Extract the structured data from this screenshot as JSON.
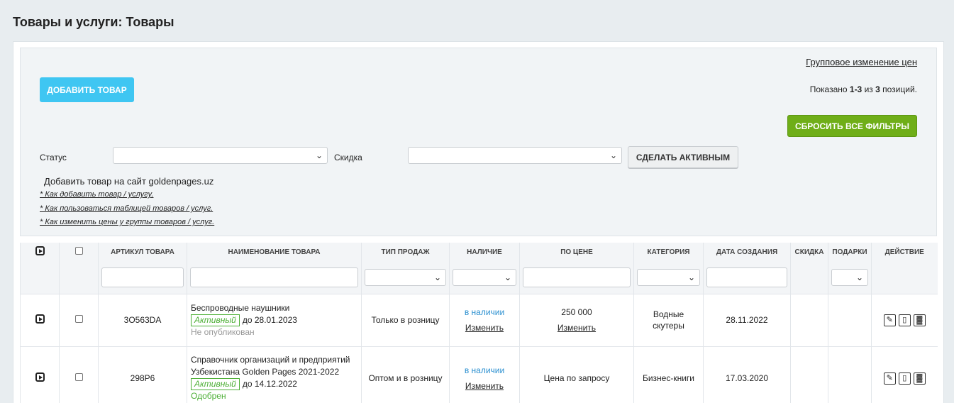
{
  "page": {
    "title": "Товары и услуги: Товары"
  },
  "toolbar": {
    "bulk_price_link": "Групповое изменение цен",
    "add_button": "ДОБАВИТЬ ТОВАР",
    "shown_prefix": "Показано ",
    "shown_range": "1-3",
    "shown_mid": " из ",
    "shown_total": "3",
    "shown_suffix": " позиций.",
    "reset_button": "СБРОСИТЬ ВСЕ ФИЛЬТРЫ",
    "status_label": "Статус",
    "discount_label": "Скидка",
    "make_active_button": "СДЕЛАТЬ АКТИВНЫМ",
    "hint": "Добавить товар на сайт goldenpages.uz",
    "help_links": [
      "* Как добавить товар / услугу.",
      "* Как пользоваться таблицей товаров / услуг.",
      "* Как изменить цены у группы товаров / услуг."
    ]
  },
  "table": {
    "headers": [
      "АРТИКУЛ ТОВАРА",
      "НАИМЕНОВАНИЕ ТОВАРА",
      "ТИП ПРОДАЖ",
      "НАЛИЧИЕ",
      "ПО ЦЕНЕ",
      "КАТЕГОРИЯ",
      "ДАТА СОЗДАНИЯ",
      "СКИДКА",
      "ПОДАРКИ",
      "ДЕЙСТВИЕ"
    ],
    "rows": [
      {
        "sku": "3O563DA",
        "name": "Беспроводные наушники",
        "status": "Активный",
        "until": "до 28.01.2023",
        "publish": "Не опубликован",
        "sale_type": "Только в розницу",
        "availability": "в наличии",
        "availability_edit": "Изменить",
        "price": "250 000",
        "price_edit": "Изменить",
        "category": "Водные скутеры",
        "created": "28.11.2022"
      },
      {
        "sku": "298P6",
        "name": "Справочник организаций и предприятий Узбекистана Golden Pages 2021-2022",
        "status": "Активный",
        "until": "до 14.12.2022",
        "publish": "Одобрен",
        "sale_type": "Оптом и в розницу",
        "availability": "в наличии",
        "availability_edit": "Изменить",
        "price": "Цена по запросу",
        "category": "Бизнес-книги",
        "created": "17.03.2020"
      }
    ]
  }
}
